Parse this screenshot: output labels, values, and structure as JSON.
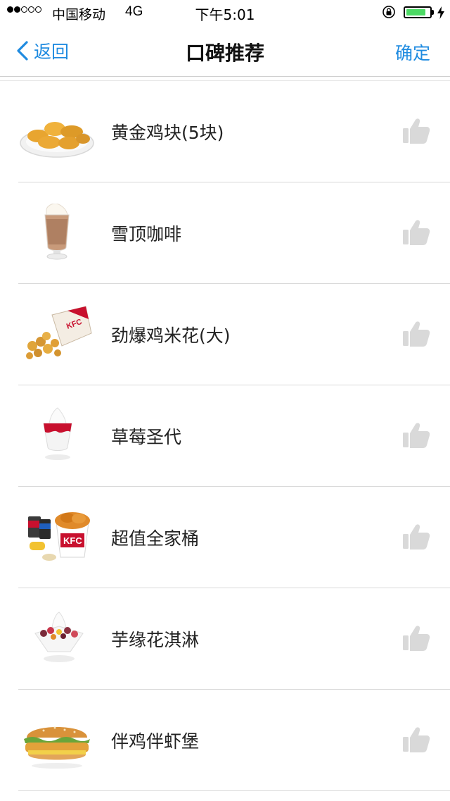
{
  "status_bar": {
    "carrier": "中国移动",
    "network": "4G",
    "time": "下午5:01",
    "signal_bars_filled": 2,
    "signal_bars_total": 5,
    "battery_level": 0.85,
    "battery_color": "#4cd964",
    "icons": [
      "orientation-lock-icon",
      "battery-icon",
      "charging-icon"
    ]
  },
  "nav": {
    "back_label": "返回",
    "title": "口碑推荐",
    "confirm_label": "确定",
    "accent_color": "#1f8be0"
  },
  "items": [
    {
      "name": "黄金鸡块(5块)",
      "image": "chicken-nuggets-image"
    },
    {
      "name": "雪顶咖啡",
      "image": "iced-coffee-image"
    },
    {
      "name": "劲爆鸡米花(大)",
      "image": "popcorn-chicken-image"
    },
    {
      "name": "草莓圣代",
      "image": "strawberry-sundae-image"
    },
    {
      "name": "超值全家桶",
      "image": "family-bucket-image"
    },
    {
      "name": "芋缘花淇淋",
      "image": "taro-ice-cream-image"
    },
    {
      "name": "伴鸡伴虾堡",
      "image": "chicken-shrimp-burger-image"
    }
  ],
  "like_icon": "thumbs-up-icon"
}
